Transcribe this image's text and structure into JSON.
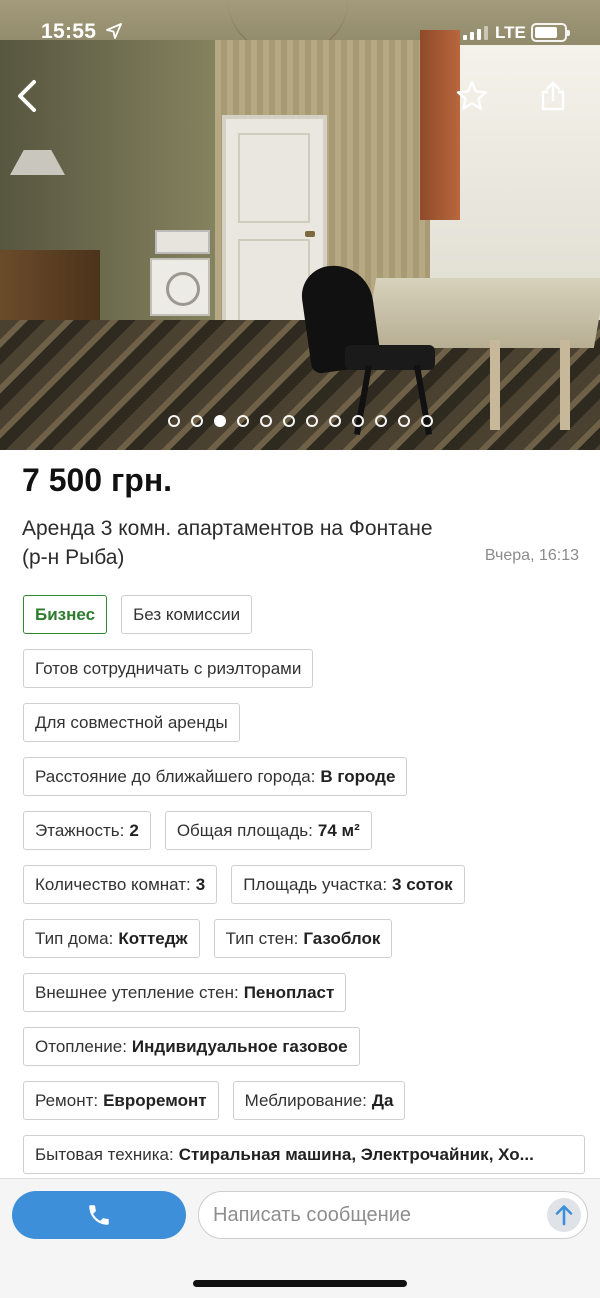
{
  "status_bar": {
    "time": "15:55",
    "network": "LTE"
  },
  "gallery": {
    "photo_count": 12,
    "active_index": 2
  },
  "listing": {
    "price": "7 500 грн.",
    "title": "Аренда 3 комн. апартаментов на Фонтане (р-н Рыба)",
    "date": "Вчера, 16:13"
  },
  "tags": {
    "business": "Бизнес",
    "no_commission": "Без комиссии",
    "realtors": "Готов сотрудничать с риэлторами",
    "joint_rent": "Для совместной аренды",
    "distance": {
      "label": "Расстояние до ближайшего города:",
      "value": "В городе"
    },
    "floors": {
      "label": "Этажность:",
      "value": "2"
    },
    "area": {
      "label": "Общая площадь:",
      "value": "74 м²"
    },
    "rooms": {
      "label": "Количество комнат:",
      "value": "3"
    },
    "plot": {
      "label": "Площадь участка:",
      "value": "3 соток"
    },
    "house_type": {
      "label": "Тип дома:",
      "value": "Коттедж"
    },
    "wall_type": {
      "label": "Тип стен:",
      "value": "Газоблок"
    },
    "insulation": {
      "label": "Внешнее утепление стен:",
      "value": "Пенопласт"
    },
    "heating": {
      "label": "Отопление:",
      "value": "Индивидуальное газовое"
    },
    "repair": {
      "label": "Ремонт:",
      "value": "Евроремонт"
    },
    "furnished": {
      "label": "Меблирование:",
      "value": "Да"
    },
    "appliances": {
      "label": "Бытовая техника:",
      "value": "Стиральная машина, Электрочайник, Хо..."
    }
  },
  "bottom_bar": {
    "message_placeholder": "Написать сообщение"
  },
  "colors": {
    "accent": "#3d8fd9",
    "business_green": "#2e8a2e"
  },
  "icons": [
    "back-arrow-icon",
    "star-icon",
    "share-icon",
    "phone-icon",
    "send-arrow-icon",
    "location-arrow-icon"
  ]
}
